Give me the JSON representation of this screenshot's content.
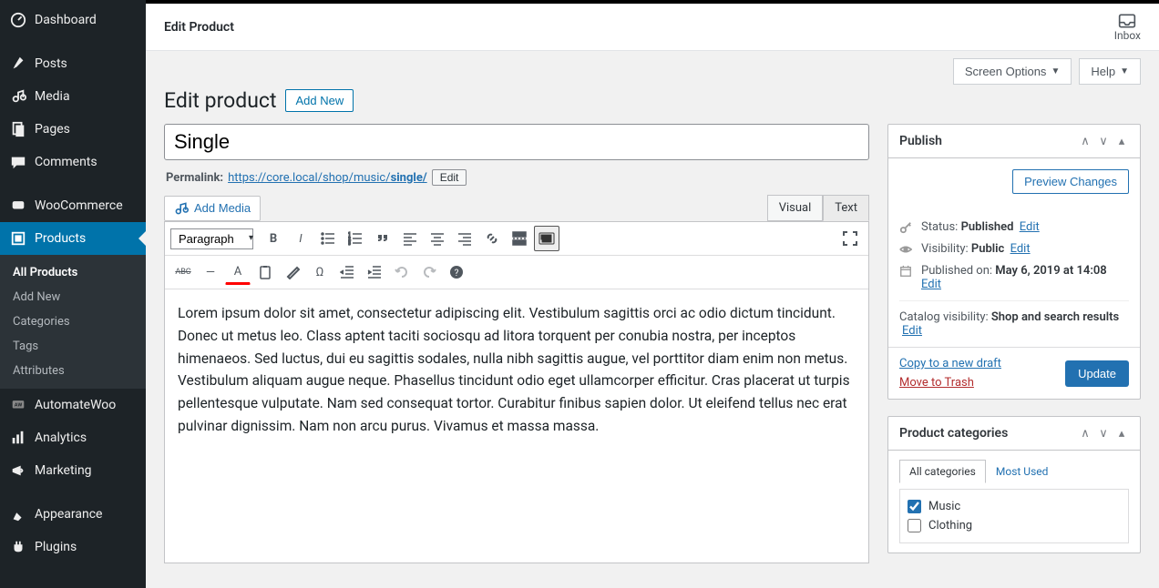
{
  "sidebar": {
    "items": [
      {
        "label": "Dashboard",
        "icon": "dashboard"
      },
      {
        "label": "Posts",
        "icon": "pin"
      },
      {
        "label": "Media",
        "icon": "media"
      },
      {
        "label": "Pages",
        "icon": "pages"
      },
      {
        "label": "Comments",
        "icon": "comments"
      },
      {
        "label": "WooCommerce",
        "icon": "woo"
      },
      {
        "label": "Products",
        "icon": "products"
      },
      {
        "label": "AutomateWoo",
        "icon": "aw"
      },
      {
        "label": "Analytics",
        "icon": "analytics"
      },
      {
        "label": "Marketing",
        "icon": "marketing"
      },
      {
        "label": "Appearance",
        "icon": "appearance"
      },
      {
        "label": "Plugins",
        "icon": "plugins"
      }
    ],
    "sub": [
      {
        "label": "All Products"
      },
      {
        "label": "Add New"
      },
      {
        "label": "Categories"
      },
      {
        "label": "Tags"
      },
      {
        "label": "Attributes"
      }
    ]
  },
  "topbar": {
    "title": "Edit Product",
    "inbox_label": "Inbox"
  },
  "header_controls": {
    "screen_options": "Screen Options",
    "help": "Help"
  },
  "page": {
    "heading": "Edit product",
    "add_new": "Add New",
    "title_value": "Single",
    "permalink_label": "Permalink:",
    "permalink_base": "https://core.local/shop/music/",
    "permalink_slug": "single/",
    "permalink_edit": "Edit"
  },
  "editor": {
    "add_media": "Add Media",
    "tab_visual": "Visual",
    "tab_text": "Text",
    "format_select": "Paragraph",
    "content": "Lorem ipsum dolor sit amet, consectetur adipiscing elit. Vestibulum sagittis orci ac odio dictum tincidunt. Donec ut metus leo. Class aptent taciti sociosqu ad litora torquent per conubia nostra, per inceptos himenaeos. Sed luctus, dui eu sagittis sodales, nulla nibh sagittis augue, vel porttitor diam enim non metus. Vestibulum aliquam augue neque. Phasellus tincidunt odio eget ullamcorper efficitur. Cras placerat ut turpis pellentesque vulputate. Nam sed consequat tortor. Curabitur finibus sapien dolor. Ut eleifend tellus nec erat pulvinar dignissim. Nam non arcu purus. Vivamus et massa massa."
  },
  "publish": {
    "box_title": "Publish",
    "preview_btn": "Preview Changes",
    "status_label": "Status:",
    "status_value": "Published",
    "visibility_label": "Visibility:",
    "visibility_value": "Public",
    "published_label": "Published on:",
    "published_value": "May 6, 2019 at 14:08",
    "catalog_label": "Catalog visibility:",
    "catalog_value": "Shop and search results",
    "edit_link": "Edit",
    "copy_draft": "Copy to a new draft",
    "move_trash": "Move to Trash",
    "update_btn": "Update"
  },
  "categories": {
    "box_title": "Product categories",
    "tab_all": "All categories",
    "tab_most": "Most Used",
    "items": [
      {
        "label": "Music",
        "checked": true
      },
      {
        "label": "Clothing",
        "checked": false
      }
    ]
  }
}
